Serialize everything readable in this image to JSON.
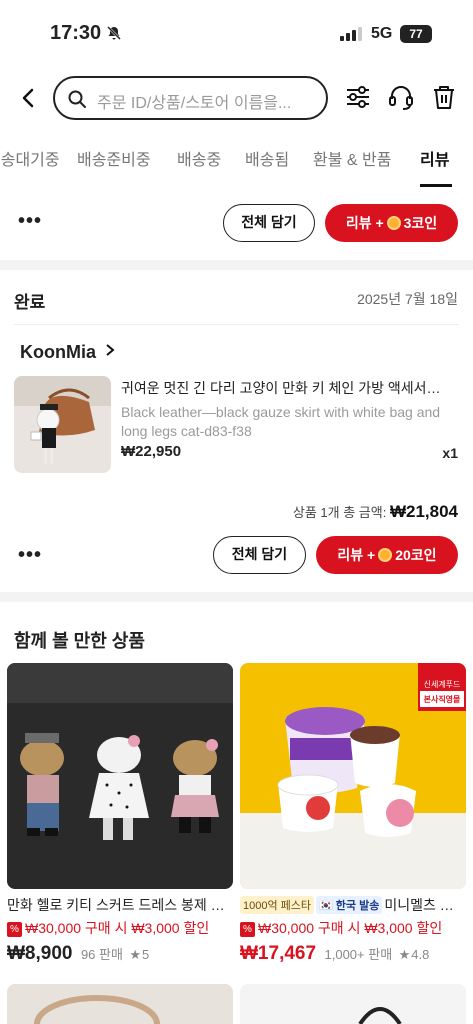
{
  "status_bar": {
    "time": "17:30",
    "network": "5G",
    "battery": "77"
  },
  "header": {
    "search_placeholder": "주문 ID/상품/스토어 이름을..."
  },
  "tabs": [
    "배송대기중",
    "배송준비중",
    "배송중",
    "배송됨",
    "환불 & 반품",
    "리뷰"
  ],
  "active_tab": "리뷰",
  "top_actions": {
    "more": "•••",
    "add_all": "전체 담기",
    "review_prefix": "리뷰 +",
    "review_reward": "3코인"
  },
  "order": {
    "status": "완료",
    "date": "2025년 7월 18일",
    "store": "KoonMia",
    "product": {
      "title": "귀여운 멋진 긴 다리 고양이 만화 키 체인 가방 액세서리 펜던트",
      "variant": "Black leather—black gauze skirt with white bag and long legs cat-d83-f38",
      "price": "₩22,950",
      "qty": "x1"
    },
    "total_label": "상품 1개 총 금액:",
    "total_value": "₩21,804",
    "more": "•••",
    "add_all": "전체 담기",
    "review_prefix": "리뷰 +",
    "review_reward": "20코인"
  },
  "recommend": {
    "title": "함께 볼 만한 상품",
    "items": [
      {
        "name": "만화 헬로 키티 스커트 드레스 봉제 인형 키 체인",
        "promo": "₩30,000 구매 시 ₩3,000 할인",
        "price": "₩8,900",
        "sold": "96 판매",
        "rating": "5"
      },
      {
        "tag1": "1000억 페스타",
        "tag2": "한국 발송",
        "name": "미니멜츠 아이스크림",
        "promo": "₩30,000 구매 시 ₩3,000 할인",
        "price": "₩17,467",
        "sold": "1,000+ 판매",
        "rating": "4.8",
        "badge_line1": "신세계푸드",
        "badge_line2": "본사직영몰"
      }
    ]
  },
  "colors": {
    "accent": "#d8131f",
    "coin": "#ffb02e"
  }
}
